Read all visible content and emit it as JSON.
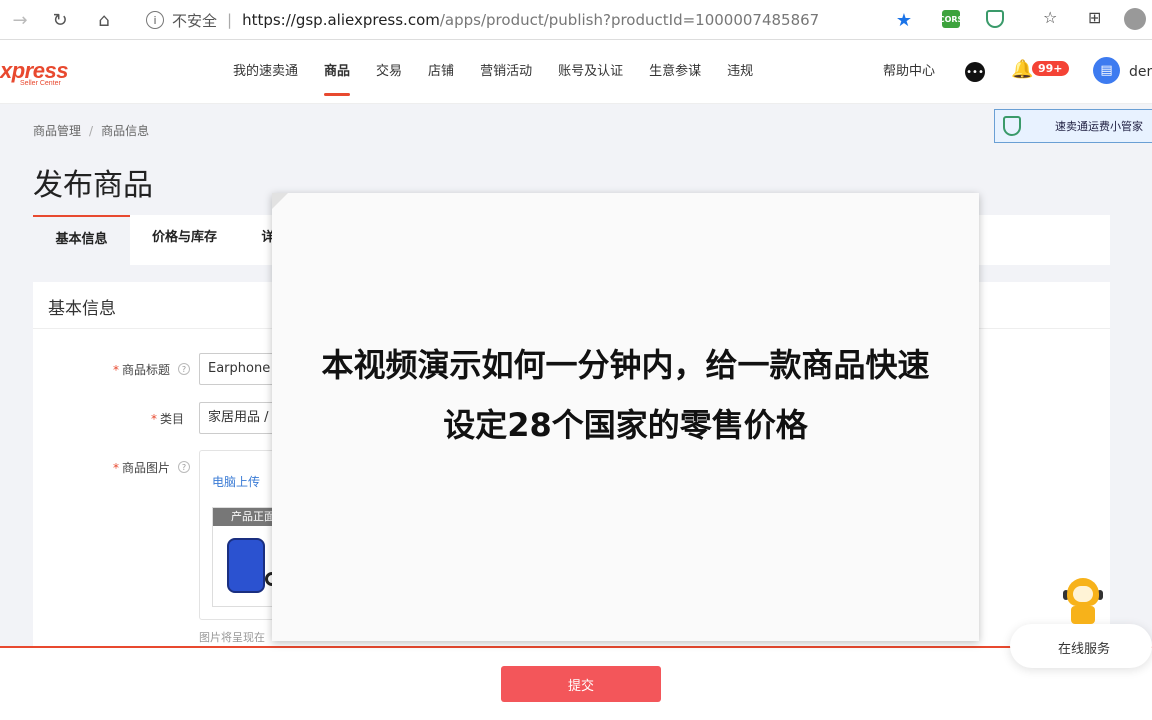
{
  "browser": {
    "security": "不安全",
    "url_host": "https://gsp.aliexpress.com",
    "url_path": "/apps/product/publish?productId=1000007485867",
    "ext_cors": "CORS"
  },
  "header": {
    "logo_main": "xpress",
    "logo_sub": "Seller Center",
    "nav": [
      "我的速卖通",
      "商品",
      "交易",
      "店铺",
      "营销活动",
      "账号及认证",
      "生意参谋",
      "违规"
    ],
    "active_nav": "商品",
    "help": "帮助中心",
    "badge": "99+",
    "user": "den"
  },
  "float_widget": {
    "label": "速卖通运费小管家"
  },
  "breadcrumb": [
    "商品管理",
    "商品信息"
  ],
  "page_title": "发布商品",
  "tabs": [
    "基本信息",
    "价格与库存",
    "详"
  ],
  "panel": {
    "title": "基本信息",
    "product_title_label": "商品标题",
    "product_title_value": "Earphone C",
    "category_label": "类目",
    "category_value": "家居用品 / 收",
    "images_label": "商品图片",
    "upload_link": "电脑上传",
    "thumb_label": "产品正面",
    "img_hint": "图片将呈现在"
  },
  "submit": "提交",
  "service": "在线服务",
  "overlay": {
    "line1": "本视频演示如何一分钟内，给一款商品快速",
    "line2": "设定28个国家的零售价格"
  }
}
